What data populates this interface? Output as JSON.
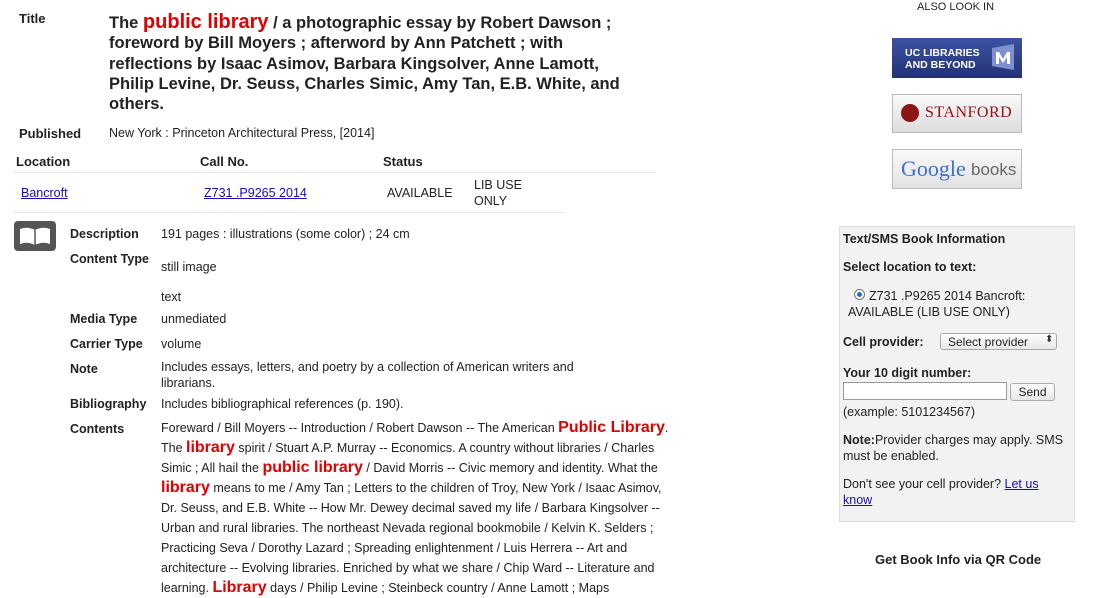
{
  "record": {
    "title_label": "Title",
    "title_parts": [
      "The ",
      "public library",
      " / a photographic essay by Robert Dawson ; foreword by Bill Moyers ; afterword by Ann Patchett ; with reflections by Isaac Asimov, Barbara Kingsolver, Anne Lamott, Philip Levine, Dr. Seuss, Charles Simic, Amy Tan, E.B. White, and others."
    ],
    "published_label": "Published",
    "published_value": "New York : Princeton Architectural Press, [2014]"
  },
  "holdings": {
    "headers": {
      "location": "Location",
      "call_no": "Call No.",
      "status": "Status"
    },
    "row": {
      "location": "Bancroft",
      "call_no": "Z731 .P9265 2014",
      "status": "AVAILABLE",
      "note": "LIB USE ONLY"
    }
  },
  "details": {
    "description_label": "Description",
    "description_value": "191 pages : illustrations (some color) ; 24 cm",
    "content_type_label": "Content Type",
    "content_type_values": [
      "still image",
      "text"
    ],
    "media_type_label": "Media Type",
    "media_type_value": "unmediated",
    "carrier_type_label": "Carrier Type",
    "carrier_type_value": "volume",
    "note_label": "Note",
    "note_value": "Includes essays, letters, and poetry by a collection of American writers and librarians.",
    "bibliography_label": "Bibliography",
    "bibliography_value": "Includes bibliographical references (p. 190).",
    "contents_label": "Contents",
    "contents_parts": [
      {
        "t": "Foreward / Bill Moyers -- Introduction / Robert Dawson -- The American ",
        "h": false
      },
      {
        "t": "Public Library",
        "h": true
      },
      {
        "t": ". The ",
        "h": false
      },
      {
        "t": "library",
        "h": true
      },
      {
        "t": " spirit / Stuart A.P. Murray -- Economics. A country without libraries / Charles Simic ; All hail the ",
        "h": false
      },
      {
        "t": "public library",
        "h": true
      },
      {
        "t": " / David Morris -- Civic memory and identity. What the ",
        "h": false
      },
      {
        "t": "library",
        "h": true
      },
      {
        "t": " means to me / Amy Tan ; Letters to the children of Troy, New York / Isaac Asimov, Dr. Seuss, and E.B. White -- How Mr. Dewey decimal saved my life / Barbara Kingsolver -- Urban and rural libraries. The northeast Nevada regional bookmobile / Kelvin K. Selders ; Practicing Seva / Dorothy Lazard ; Spreading enlightenment / Luis Herrera -- Art and architecture -- Evolving libraries. Enriched by what we share / Chip Ward -- Literature and learning. ",
        "h": false
      },
      {
        "t": "Library",
        "h": true
      },
      {
        "t": " days / Philip Levine ; Steinbeck country / Anne Lamott ; Maps",
        "h": false
      }
    ]
  },
  "sidebar": {
    "also_look_in": "ALSO LOOK IN",
    "uc_libraries_line1": "UC LIBRARIES",
    "uc_libraries_line2": "AND BEYOND",
    "stanford": "STANFORD",
    "google_books_google": "Google",
    "google_books_books": "books",
    "sms": {
      "title": "Text/SMS Book Information",
      "select_location": "Select location to text:",
      "location_option": "Z731 .P9265 2014 Bancroft: AVAILABLE (LIB USE ONLY)",
      "cell_provider_label": "Cell provider:",
      "cell_provider_selected": "Select provider",
      "number_label": "Your 10 digit number:",
      "number_value": "",
      "send_label": "Send",
      "example": "(example: 5101234567)",
      "note_bold": "Note:",
      "note_text": "Provider charges may apply. SMS must be enabled.",
      "dont_see": "Don't see your cell provider?",
      "let_us_know": "Let us know"
    },
    "qr_title": "Get Book Info via QR Code"
  },
  "colors": {
    "highlight": "#e00000",
    "link": "#1a0dab",
    "uc_bg": "#2b3f86",
    "stanford_red": "#8c1515"
  }
}
